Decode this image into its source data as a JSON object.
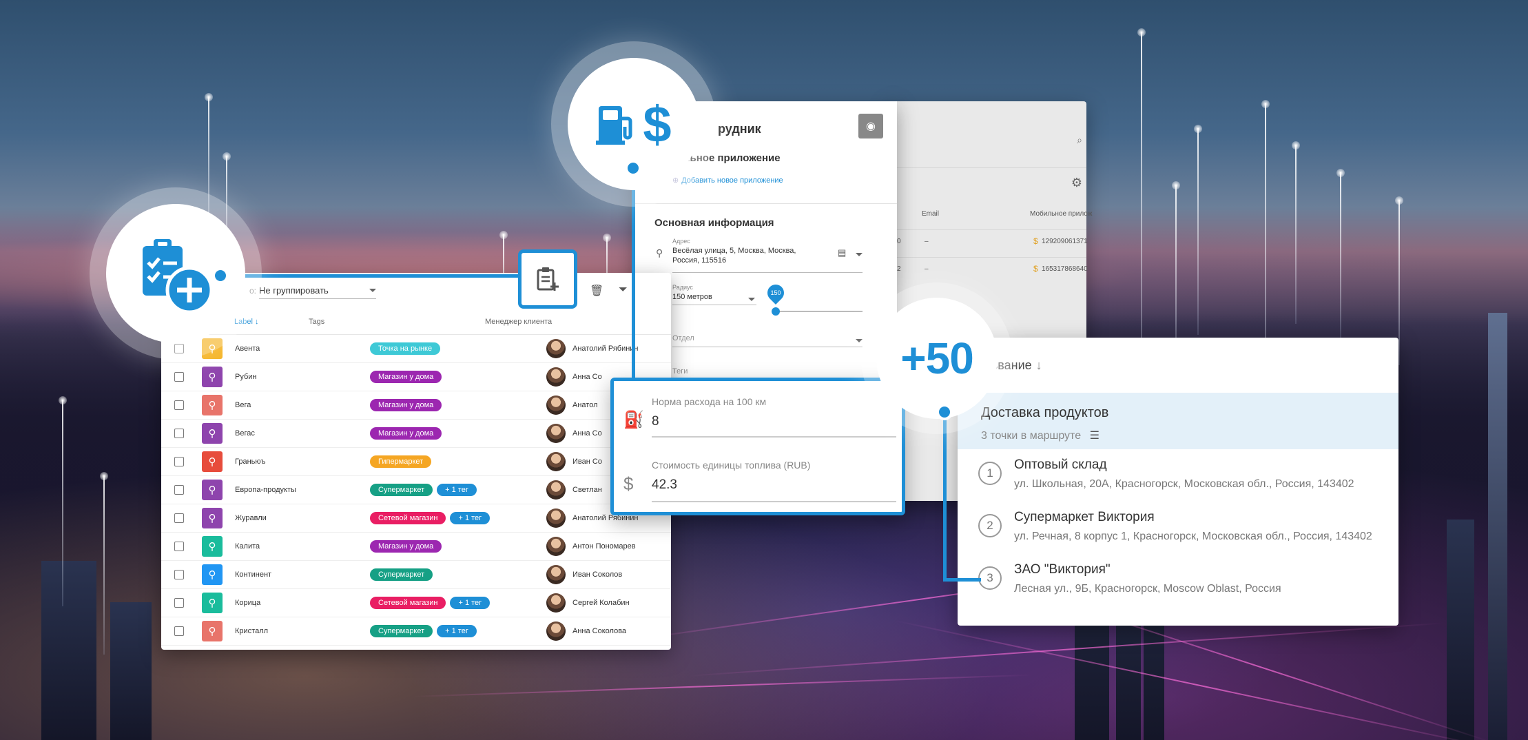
{
  "customers": {
    "group_label": "о:",
    "group_value": "Не группировать",
    "columns": {
      "label": "Label",
      "tags": "Tags",
      "manager": "Менеджер клиента"
    },
    "rows": [
      {
        "name": "Авента",
        "pin_color": "#f5b323",
        "tags": [
          {
            "text": "Точка на рынке",
            "color": "#3ec9d6"
          }
        ],
        "manager": "Анатолий Рябинин"
      },
      {
        "name": "Рубин",
        "pin_color": "#8e44ad",
        "tags": [
          {
            "text": "Магазин у дома",
            "color": "#9c27b0"
          }
        ],
        "manager": "Анна Со"
      },
      {
        "name": "Вега",
        "pin_color": "#e8746a",
        "tags": [
          {
            "text": "Магазин у дома",
            "color": "#9c27b0"
          }
        ],
        "manager": "Анатол"
      },
      {
        "name": "Вегас",
        "pin_color": "#8e44ad",
        "tags": [
          {
            "text": "Магазин у дома",
            "color": "#9c27b0"
          }
        ],
        "manager": "Анна Со"
      },
      {
        "name": "Граньюъ",
        "pin_color": "#e74c3c",
        "tags": [
          {
            "text": "Гипермаркет",
            "color": "#f5a623"
          }
        ],
        "manager": "Иван Со"
      },
      {
        "name": "Европа-продукты",
        "pin_color": "#8e44ad",
        "tags": [
          {
            "text": "Супермаркет",
            "color": "#16a085"
          },
          {
            "text": "+ 1 тег",
            "color": "#1e8fd6"
          }
        ],
        "manager": "Светлан"
      },
      {
        "name": "Журавли",
        "pin_color": "#8e44ad",
        "tags": [
          {
            "text": "Сетевой магазин",
            "color": "#e91e63"
          },
          {
            "text": "+ 1 тег",
            "color": "#1e8fd6"
          }
        ],
        "manager": "Анатолий Рябинин"
      },
      {
        "name": "Калита",
        "pin_color": "#1abc9c",
        "tags": [
          {
            "text": "Магазин у дома",
            "color": "#9c27b0"
          }
        ],
        "manager": "Антон Пономарев"
      },
      {
        "name": "Континент",
        "pin_color": "#2196f3",
        "tags": [
          {
            "text": "Супермаркет",
            "color": "#16a085"
          }
        ],
        "manager": "Иван Соколов"
      },
      {
        "name": "Корица",
        "pin_color": "#1abc9c",
        "tags": [
          {
            "text": "Сетевой магазин",
            "color": "#e91e63"
          },
          {
            "text": "+ 1 тег",
            "color": "#1e8fd6"
          }
        ],
        "manager": "Сергей Колабин"
      },
      {
        "name": "Кристалл",
        "pin_color": "#e8746a",
        "tags": [
          {
            "text": "Супермаркет",
            "color": "#16a085"
          },
          {
            "text": "+ 1 тег",
            "color": "#1e8fd6"
          }
        ],
        "manager": "Анна Соколова"
      }
    ]
  },
  "employee": {
    "title": "рудник",
    "mobile_section": "льное приложение",
    "add_app_link": "Добавить новое приложение",
    "main_info": "Основная информация",
    "address_label": "Адрес",
    "address_value": "Весёлая улица, 5, Москва, Москва, Россия, 115516",
    "radius_label": "Радиус",
    "radius_value": "150 метров",
    "slider_value": "150",
    "dept_label": "Отдел",
    "tags_label": "Теги",
    "bg_email": "Email",
    "bg_mobile": "Мобильное прилож",
    "bg_row1_dash": "–",
    "bg_row2_dash": "–",
    "bg_row1_num": "129209061371",
    "bg_row2_num": "165317868640",
    "bg_row1_lead": "0",
    "bg_row2_lead": "2"
  },
  "fuel": {
    "rate_label": "Норма расхода на 100 км",
    "rate_value": "8",
    "cost_label": "Стоимость единицы топлива (RUB)",
    "cost_value": "42.3"
  },
  "routes": {
    "sort_label": "звание",
    "selected_title": "Доставка продуктов",
    "selected_sub": "3 точки в маршруте",
    "stops": [
      {
        "num": "1",
        "name": "Оптовый склад",
        "address": "ул. Школьная, 20А, Красногорск, Московская обл., Россия, 143402"
      },
      {
        "num": "2",
        "name": "Супермаркет Виктория",
        "address": "ул. Речная, 8 корпус 1, Красногорск, Московская обл., Россия, 143402"
      },
      {
        "num": "3",
        "name": "ЗАО \"Виктория\"",
        "address": "Лесная ул., 9Б, Красногорск, Moscow Oblast, Россия"
      }
    ]
  },
  "badges": {
    "plus50": "+50",
    "currency_symbol": "$"
  },
  "accent_color": "#1e8fd6",
  "icons": [
    "clipboard-check-icon",
    "plus-icon",
    "fuel-pump-icon",
    "dollar-icon",
    "camera-icon",
    "trash-icon",
    "filter-icon",
    "clipboard-add-icon",
    "map-pin-icon",
    "radius-icon",
    "group-icon",
    "tag-icon",
    "list-icon",
    "settings-icon",
    "search-icon"
  ]
}
